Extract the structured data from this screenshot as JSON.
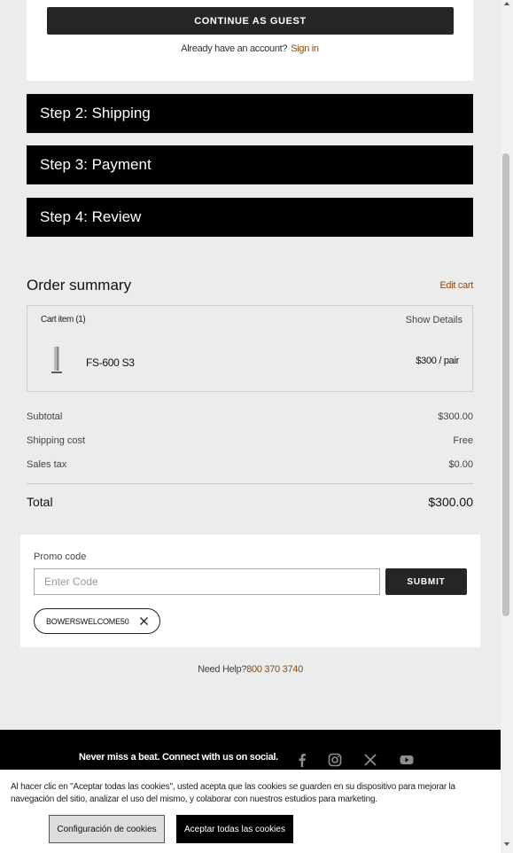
{
  "guest": {
    "continue_label": "CONTINUE AS GUEST",
    "account_prompt": "Already have an account?",
    "sign_in_label": "Sign in"
  },
  "steps": [
    {
      "label": "Step 2: Shipping"
    },
    {
      "label": "Step 3: Payment"
    },
    {
      "label": "Step 4: Review"
    }
  ],
  "order_summary": {
    "title": "Order summary",
    "edit_cart_label": "Edit cart",
    "cart_items_label": "Cart item (1)",
    "show_details_label": "Show Details",
    "item": {
      "name": "FS-600 S3",
      "price": "$300 / pair"
    },
    "rows": [
      {
        "label": "Subtotal",
        "value": "$300.00"
      },
      {
        "label": "Shipping cost",
        "value": "Free"
      },
      {
        "label": "Sales tax",
        "value": "$0.00"
      }
    ],
    "total": {
      "label": "Total",
      "value": "$300.00"
    }
  },
  "promo": {
    "label": "Promo code",
    "placeholder": "Enter Code",
    "submit_label": "SUBMIT",
    "applied_code": "BOWERSWELCOME50"
  },
  "help": {
    "prefix": "Need Help?",
    "phone": "800 370 3740"
  },
  "footer": {
    "social_text": "Never miss a beat. Connect with us on social.",
    "social_icons": [
      "facebook-icon",
      "instagram-icon",
      "x-icon",
      "youtube-icon"
    ]
  },
  "cookie": {
    "text": "Al hacer clic en \"Aceptar todas las cookies\", usted acepta que las cookies se guarden en su dispositivo para mejorar la navegación del sitio, analizar el uso del mismo, y colaborar con nuestros estudios para marketing.",
    "settings_label": "Configuración de cookies",
    "accept_label": "Aceptar todas las cookies"
  },
  "colors": {
    "accent_link": "#8a4b14",
    "step_bg": "#000000",
    "button_bg": "#262626"
  }
}
